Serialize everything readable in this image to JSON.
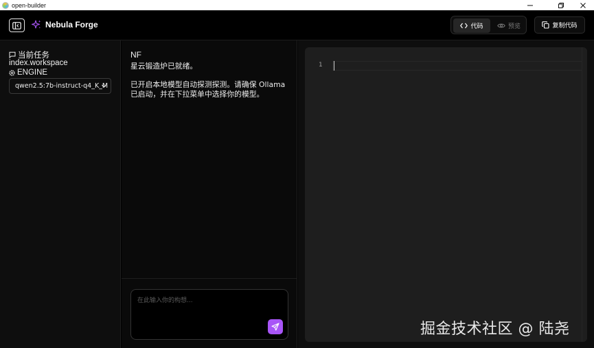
{
  "window": {
    "title": "open-builder"
  },
  "header": {
    "brand": "Nebula Forge",
    "view_toggle": {
      "code_label": "代码",
      "preview_label": "预览",
      "active": "code"
    },
    "copy_label": "复制代码"
  },
  "sidebar": {
    "task_heading": "当前任务",
    "workspace": "index.workspace",
    "engine_label": "ENGINE",
    "model_selected": "qwen2.5:7b-instruct-q4_K_M"
  },
  "chat": {
    "sender": "NF",
    "lines": [
      "星云锻造炉已就绪。",
      "已开启本地模型自动探测探测。请确保 Ollama",
      "已启动，并在下拉菜单中选择你的模型。"
    ],
    "input_placeholder": "在此输入你的构想..."
  },
  "editor": {
    "line_number": "1",
    "content": ""
  },
  "watermark": "掘金技术社区 @ 陆尧",
  "colors": {
    "accent": "#a855f7",
    "background": "#000000",
    "editor_bg": "#1e1e1e"
  },
  "icons": {
    "app": "app-logo-icon",
    "sidebar_toggle": "sidebar-toggle-icon",
    "brand": "sparkles-icon",
    "code": "code-brackets-icon",
    "preview": "eye-icon",
    "copy": "copy-icon",
    "task": "chat-bubble-icon",
    "engine": "gear-icon",
    "select": "chevron-down-icon",
    "send": "send-icon"
  }
}
